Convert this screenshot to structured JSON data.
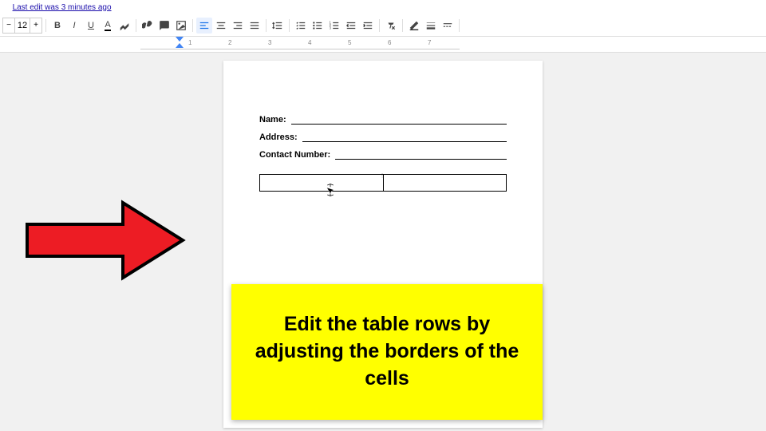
{
  "header": {
    "edit_status": "Last edit was 3 minutes ago"
  },
  "toolbar": {
    "font_size": "12",
    "minus": "−",
    "plus": "+"
  },
  "ruler": {
    "marks": [
      "1",
      "2",
      "3",
      "4",
      "5",
      "6",
      "7"
    ]
  },
  "document": {
    "field1_label": "Name:",
    "field2_label": "Address:",
    "field3_label": "Contact Number:"
  },
  "annotation": {
    "callout_text": "Edit the table rows by adjusting the borders of the cells"
  }
}
